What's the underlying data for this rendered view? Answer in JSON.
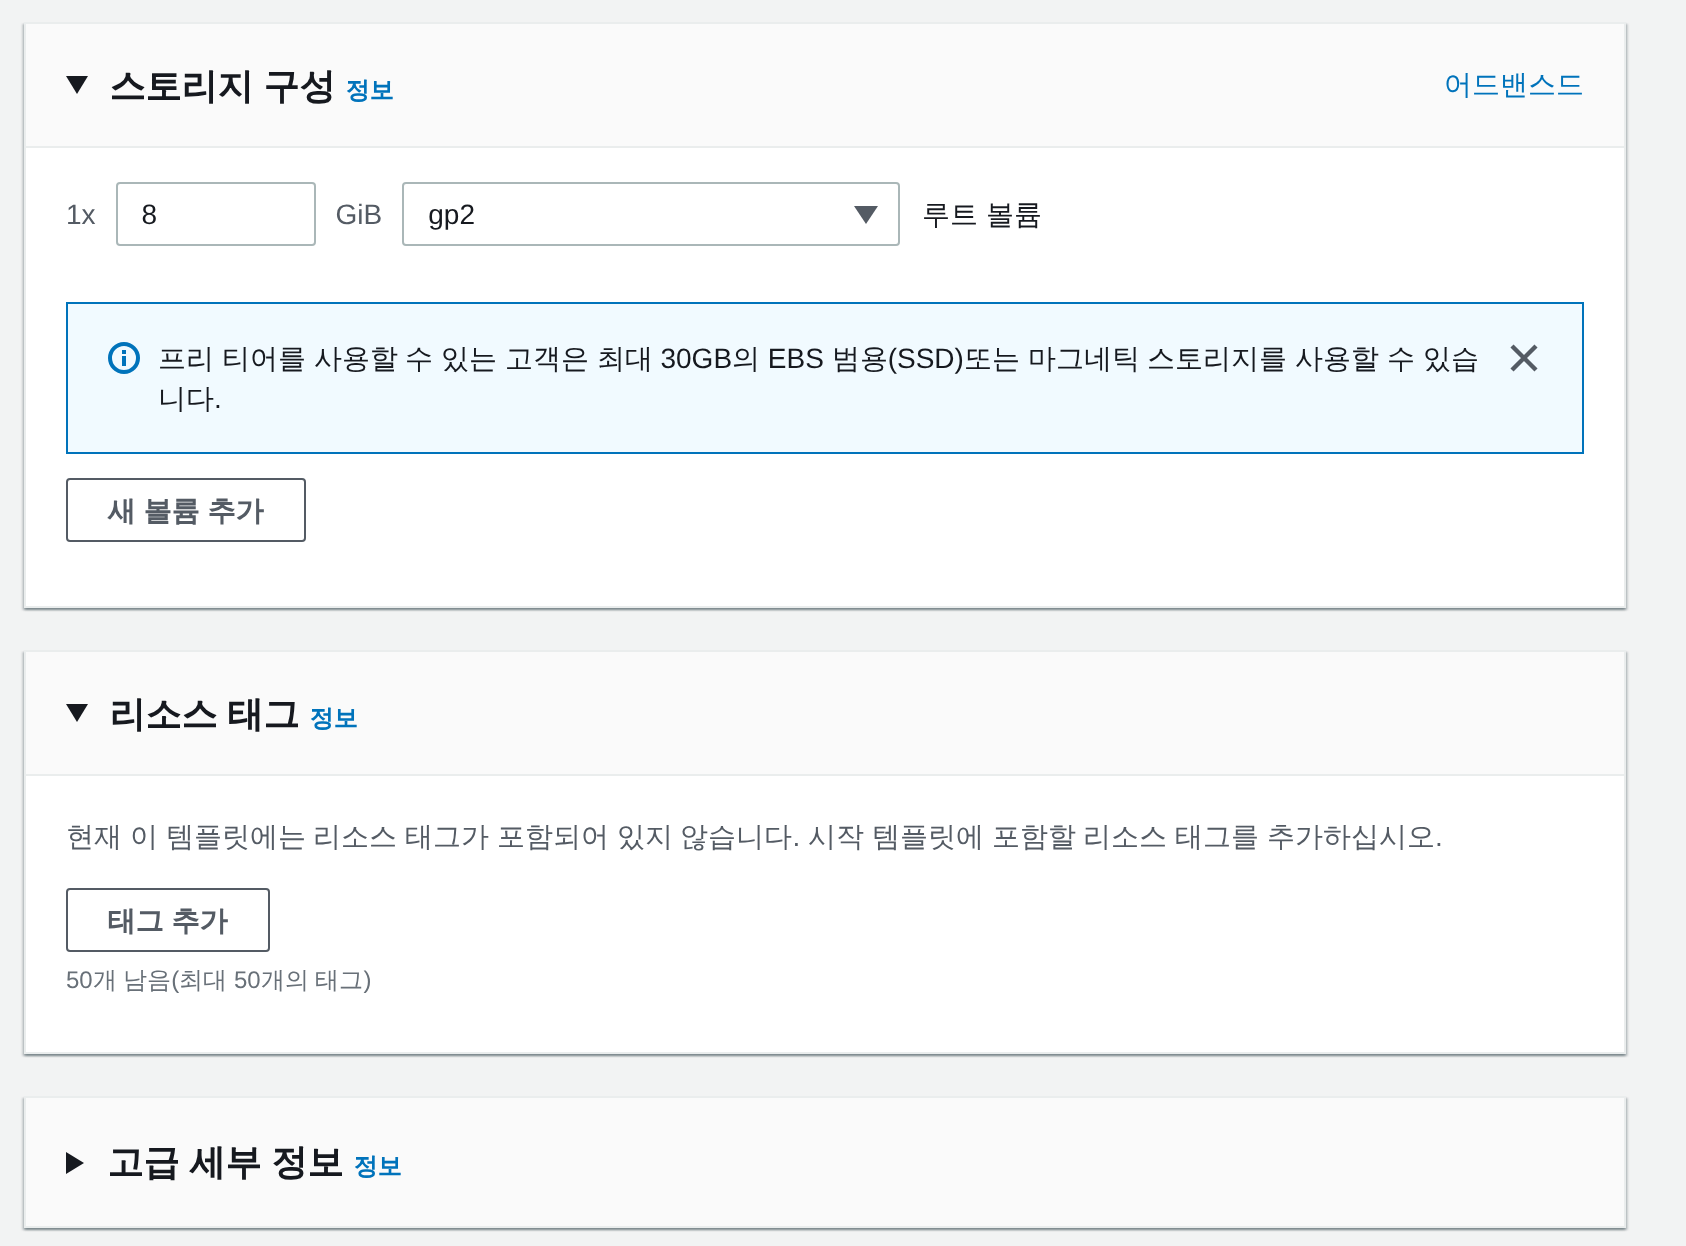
{
  "sections": [
    {
      "kind": "storage",
      "title": "스토리지 구성",
      "info_link": "정보",
      "expanded": true,
      "action_link": "어드밴스드",
      "volume": {
        "count": "1x",
        "size": "8",
        "unit": "GiB",
        "type": "gp2",
        "label": "루트 볼륨"
      },
      "alert": {
        "text": "프리 티어를 사용할 수 있는 고객은 최대 30GB의 EBS 범용(SSD)또는 마그네틱 스토리지를 사용할 수 있습니다."
      },
      "button": "새 볼륨 추가"
    },
    {
      "kind": "tags",
      "title": "리소스 태그",
      "info_link": "정보",
      "expanded": true,
      "description": "현재 이 템플릿에는 리소스 태그가 포함되어 있지 않습니다. 시작 템플릿에 포함할 리소스 태그를 추가하십시오.",
      "button": "태그 추가",
      "hint": "50개 남음(최대 50개의 태그)"
    },
    {
      "title": "고급 세부 정보",
      "info_link": "정보",
      "expanded": false
    }
  ]
}
